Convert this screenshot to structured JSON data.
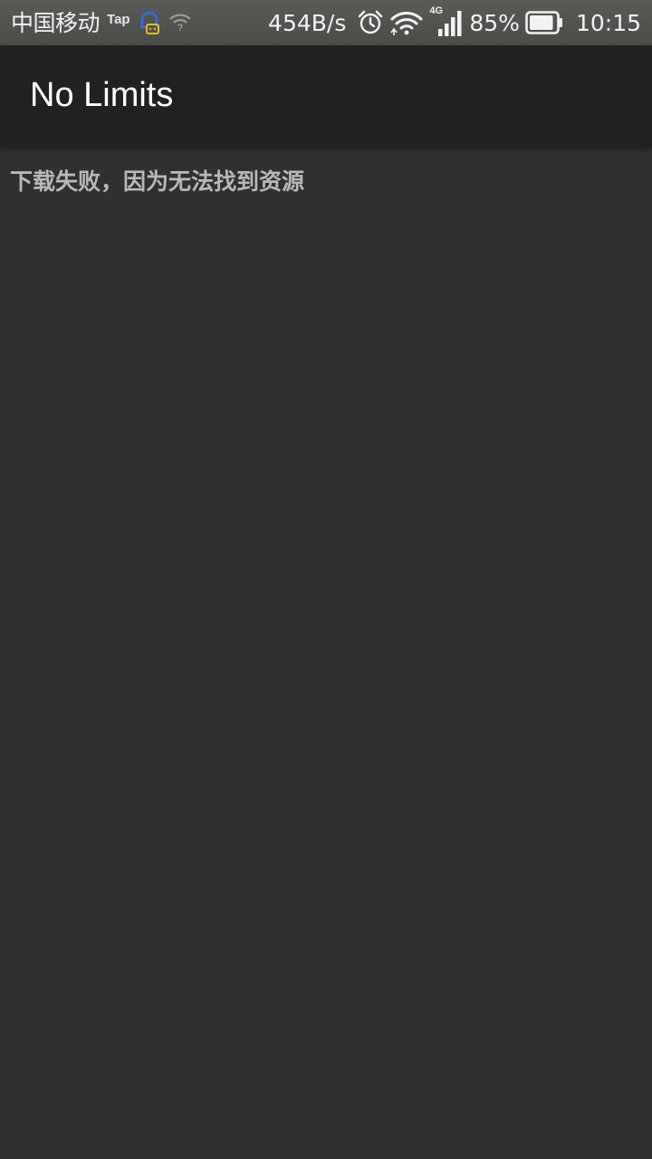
{
  "status_bar": {
    "carrier": "中国移动",
    "tap_label": "Tap",
    "net_speed": "454B/s",
    "network_type": "4G",
    "battery_percent": "85%",
    "battery_level": 0.85,
    "time": "10:15",
    "icons": [
      "notification-bell-icon",
      "wifi-question-icon",
      "alarm-clock-icon",
      "wifi-icon",
      "cell-signal-icon",
      "battery-icon"
    ]
  },
  "app_bar": {
    "title": "No Limits"
  },
  "content": {
    "message": "下载失败，因为无法找到资源"
  },
  "colors": {
    "status_bar_bg": "#4f4f4c",
    "app_bar_bg": "#212121",
    "content_bg": "#303030",
    "title_text": "#ffffff",
    "message_text": "#b8b8b8",
    "notif_icon_blue": "#2f6ee0",
    "notif_icon_yellow": "#e0c020"
  }
}
